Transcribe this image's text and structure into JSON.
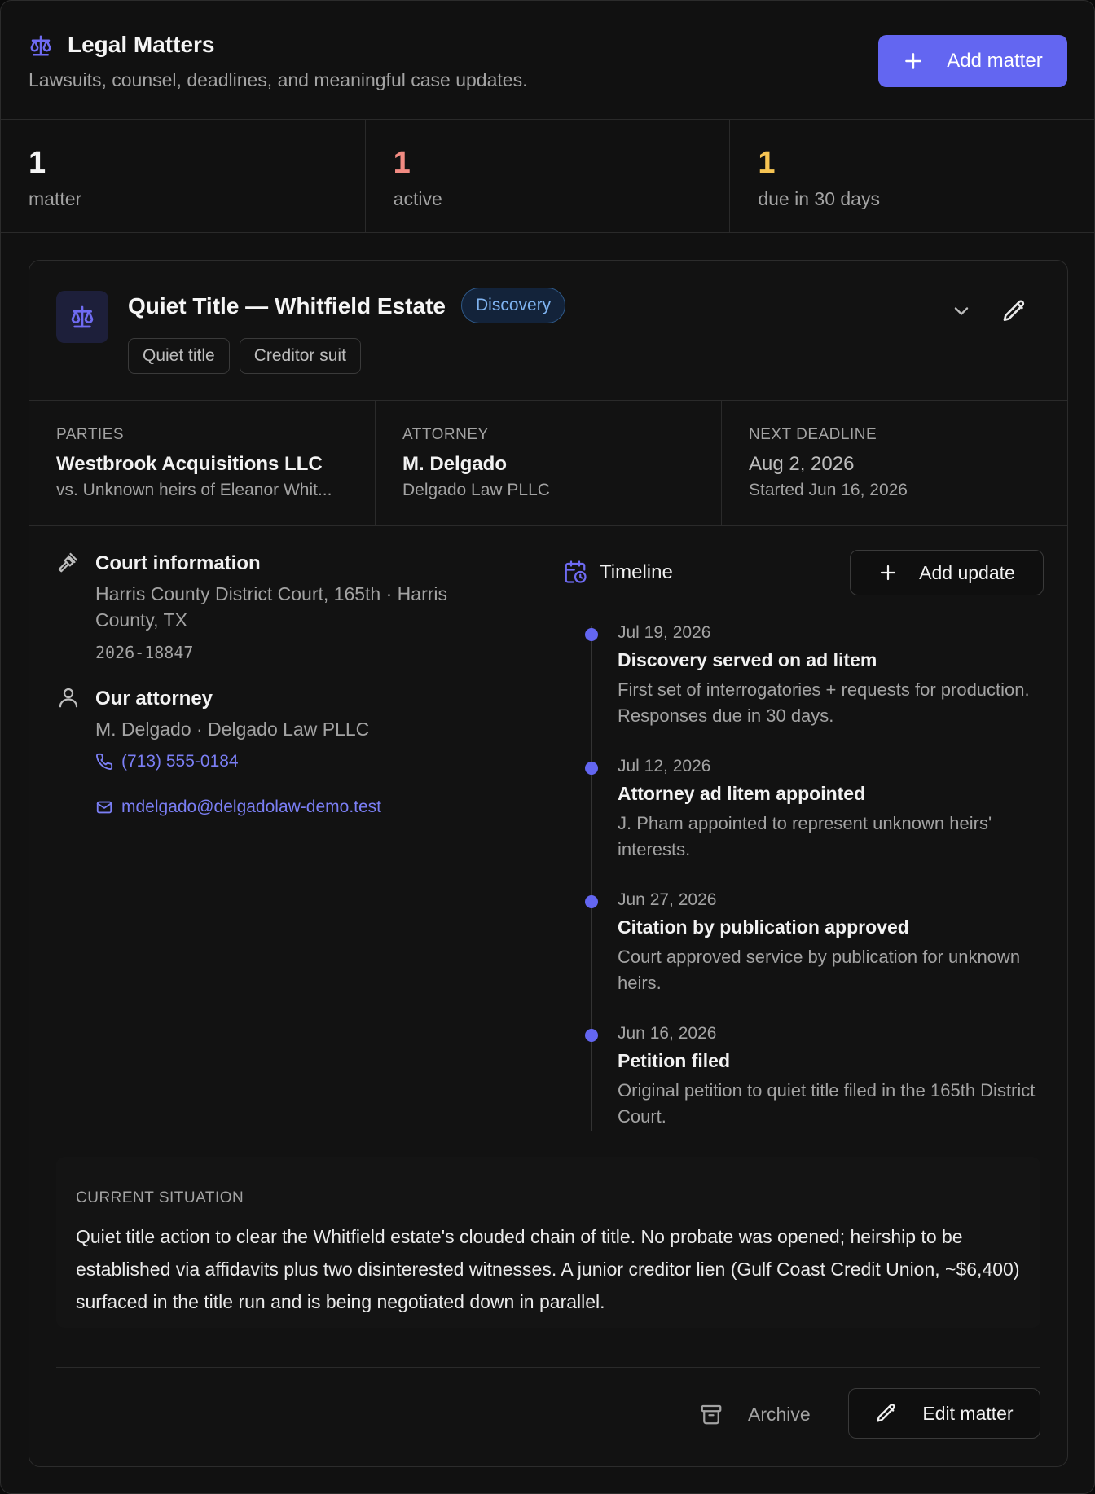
{
  "header": {
    "title": "Legal Matters",
    "subtitle": "Lawsuits, counsel, deadlines, and meaningful case updates.",
    "add_label": "Add matter"
  },
  "stats": [
    {
      "value": "1",
      "label": "matter",
      "color": "#f5f5f5"
    },
    {
      "value": "1",
      "label": "active",
      "color": "#f28b82"
    },
    {
      "value": "1",
      "label": "due in 30 days",
      "color": "#f6c453"
    }
  ],
  "matter": {
    "title": "Quiet Title — Whitfield Estate",
    "status": "Discovery",
    "tags": [
      "Quiet title",
      "Creditor suit"
    ],
    "facts": {
      "parties_label": "PARTIES",
      "parties_main": "Westbrook Acquisitions LLC",
      "parties_sub": "vs. Unknown heirs of Eleanor Whit...",
      "attorney_label": "ATTORNEY",
      "attorney_main": "M. Delgado",
      "attorney_sub": "Delgado Law PLLC",
      "deadline_label": "NEXT DEADLINE",
      "deadline_main": "Aug 2, 2026",
      "deadline_sub": "Started Jun 16, 2026"
    },
    "court": {
      "title": "Court information",
      "text": "Harris County District Court, 165th · Harris County, TX",
      "case_number": "2026-18847"
    },
    "attorney": {
      "title": "Our attorney",
      "text": "M. Delgado · Delgado Law PLLC",
      "phone": "(713) 555-0184",
      "email": "mdelgado@delgadolaw-demo.test"
    },
    "timeline": {
      "title": "Timeline",
      "add_label": "Add update",
      "items": [
        {
          "date": "Jul 19, 2026",
          "title": "Discovery served on ad litem",
          "desc": "First set of interrogatories + requests for production. Responses due in 30 days."
        },
        {
          "date": "Jul 12, 2026",
          "title": "Attorney ad litem appointed",
          "desc": "J. Pham appointed to represent unknown heirs' interests."
        },
        {
          "date": "Jun 27, 2026",
          "title": "Citation by publication approved",
          "desc": "Court approved service by publication for unknown heirs."
        },
        {
          "date": "Jun 16, 2026",
          "title": "Petition filed",
          "desc": "Original petition to quiet title filed in the 165th District Court."
        }
      ]
    },
    "situation": {
      "label": "CURRENT SITUATION",
      "text": "Quiet title action to clear the Whitfield estate's clouded chain of title. No probate was opened; heirship to be established via affidavits plus two disinterested witnesses. A junior creditor lien (Gulf Coast Credit Union, ~$6,400) surfaced in the title run and is being negotiated down in parallel."
    },
    "archive_label": "Archive",
    "edit_label": "Edit matter"
  }
}
